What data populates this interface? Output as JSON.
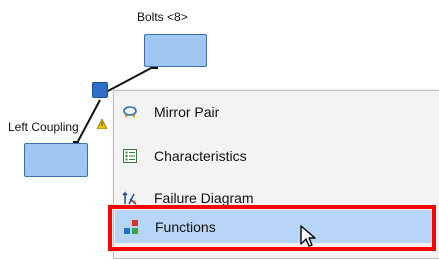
{
  "diagram": {
    "top_block_label": "Bolts <8>",
    "left_block_label": "Left Coupling"
  },
  "context_menu": {
    "items": [
      {
        "label": "Mirror Pair",
        "icon": "mirror-pair-icon"
      },
      {
        "label": "Characteristics",
        "icon": "characteristics-icon"
      },
      {
        "label": "Failure Diagram",
        "icon": "failure-diagram-icon"
      },
      {
        "label": "Functions",
        "icon": "functions-icon",
        "hovered": true
      }
    ]
  },
  "colors": {
    "block_fill": "#9fc6f0",
    "menu_background": "#f3f3f3",
    "hover_background": "#b7d5f6",
    "highlight_border": "#ff0000"
  }
}
